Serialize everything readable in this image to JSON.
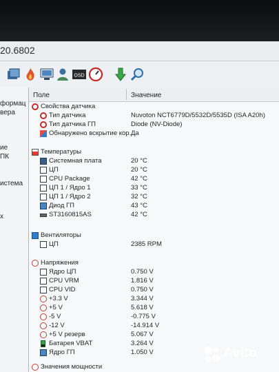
{
  "window": {
    "title_fragment": "20.6802"
  },
  "left_pane": {
    "items": [
      "формац",
      "вера",
      "",
      "ие",
      "ПК",
      "",
      "истема",
      "",
      "х"
    ]
  },
  "columns": {
    "field": "Поле",
    "value": "Значение"
  },
  "groups": {
    "sensor_props": {
      "title": "Свойства датчика",
      "rows": [
        {
          "label": "Тип датчика",
          "value": "Nuvoton NCT6779D/5532D/5535D  (ISA A20h)"
        },
        {
          "label": "Тип датчика ГП",
          "value": "Diode  (NV-Diode)"
        },
        {
          "label": "Обнаружено вскрытие кор...",
          "value": "Да"
        }
      ]
    },
    "temps": {
      "title": "Температуры",
      "rows": [
        {
          "label": "Системная плата",
          "value": "20 °C"
        },
        {
          "label": "ЦП",
          "value": "20 °C"
        },
        {
          "label": "CPU Package",
          "value": "42 °C"
        },
        {
          "label": "ЦП 1 / Ядро 1",
          "value": "33 °C"
        },
        {
          "label": "ЦП 1 / Ядро 2",
          "value": "32 °C"
        },
        {
          "label": "Диод ГП",
          "value": "43 °C"
        },
        {
          "label": "ST3160815AS",
          "value": "42 °C"
        }
      ]
    },
    "fans": {
      "title": "Вентиляторы",
      "rows": [
        {
          "label": "ЦП",
          "value": "2385 RPM"
        }
      ]
    },
    "voltages": {
      "title": "Напряжения",
      "rows": [
        {
          "label": "Ядро ЦП",
          "value": "0.750 V"
        },
        {
          "label": "CPU VRM",
          "value": "1.816 V"
        },
        {
          "label": "CPU VID",
          "value": "0.750 V"
        },
        {
          "label": "+3.3 V",
          "value": "3.344 V"
        },
        {
          "label": "+5 V",
          "value": "5.618 V"
        },
        {
          "label": "-5 V",
          "value": "-0.775 V"
        },
        {
          "label": "-12 V",
          "value": "-14.914 V"
        },
        {
          "label": "+5 V резерв",
          "value": "5.067 V"
        },
        {
          "label": "Батарея VBAT",
          "value": "3.264 V"
        },
        {
          "label": "Ядро ГП",
          "value": "1.050 V"
        }
      ]
    },
    "power": {
      "title": "Значения мощности"
    }
  },
  "watermark": {
    "text": "Avito"
  }
}
